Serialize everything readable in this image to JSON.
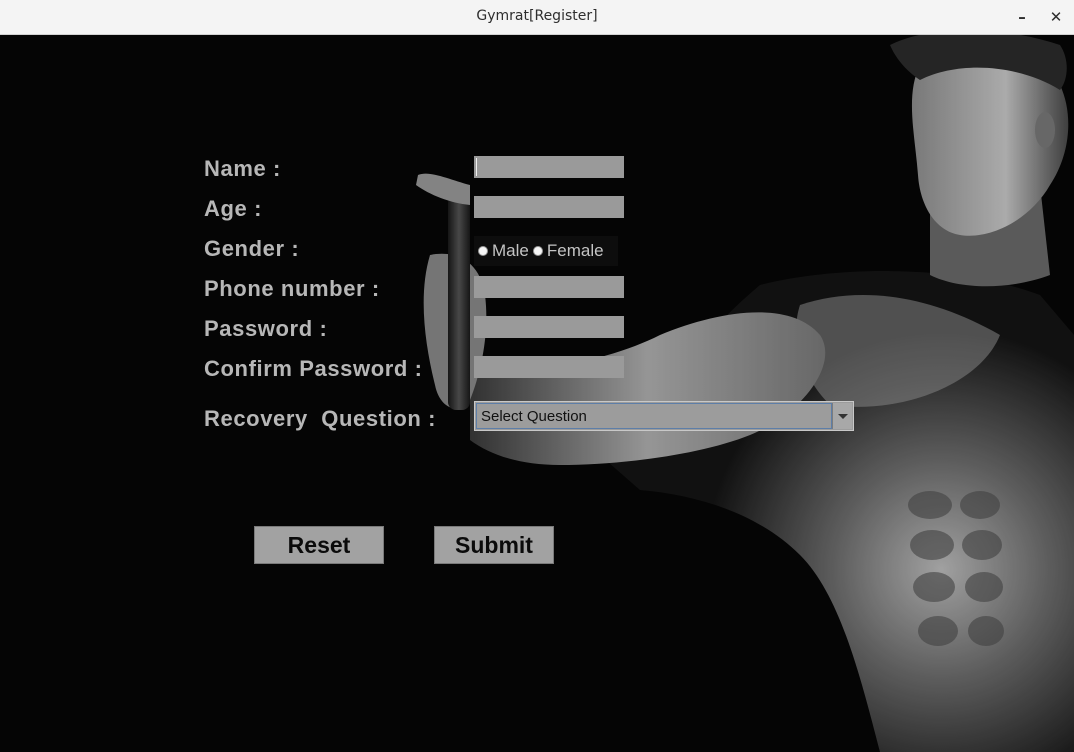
{
  "window": {
    "title": "Gymrat[Register]",
    "minimize_glyph": "–",
    "close_glyph": "✕"
  },
  "form": {
    "name_label": "Name :",
    "age_label": "Age :",
    "gender_label": "Gender :",
    "phone_label": "Phone number :",
    "password_label": "Password :",
    "confirm_password_label": "Confirm Password :",
    "recovery_label": "Recovery  Question :",
    "name_value": "",
    "age_value": "",
    "phone_value": "",
    "password_value": "",
    "confirm_password_value": "",
    "gender_options": [
      "Male",
      "Female"
    ],
    "recovery_selected": "Select Question"
  },
  "buttons": {
    "reset_label": "Reset",
    "submit_label": "Submit"
  },
  "colors": {
    "background": "#060606",
    "label": "#b7b7b7",
    "field": "#9a9a9a",
    "button": "#a2a2a2"
  },
  "icons": {
    "minimize": "minimize-icon",
    "close": "close-icon",
    "dropdown": "chevron-down-icon"
  }
}
